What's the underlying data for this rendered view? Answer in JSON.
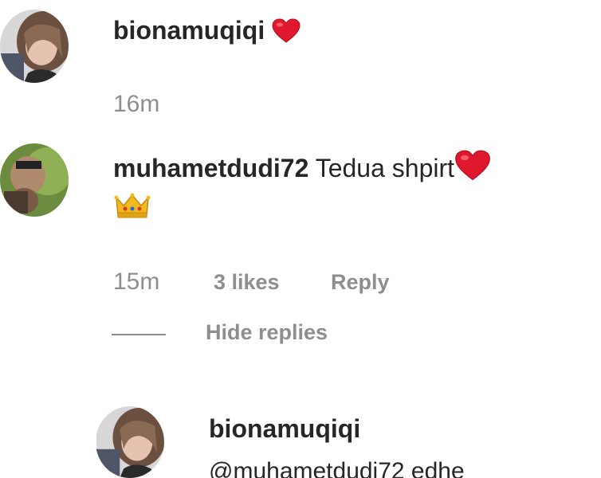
{
  "comments": [
    {
      "username": "bionamuqiqi",
      "text": "",
      "emoji": "heart-icon",
      "time": "16m"
    },
    {
      "username": "muhametdudi72",
      "text": "Tedua shpirt",
      "emoji": "heart-icon",
      "emoji2": "crown-icon",
      "time": "15m",
      "likes": "3 likes",
      "reply_label": "Reply",
      "hide_replies_label": "Hide replies"
    }
  ],
  "reply": {
    "username": "bionamuqiqi",
    "text": "@muhametdudi72 edhe"
  },
  "colors": {
    "heart": "#e0182d",
    "meta_gray": "#8e8e8e",
    "text": "#262626"
  }
}
